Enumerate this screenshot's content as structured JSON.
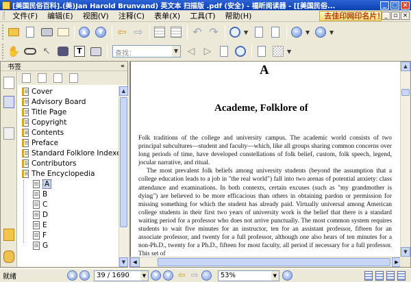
{
  "window": {
    "title": "[美国民俗百科].(美)Jan Harold Brunvand) 英文本 扫描版 .pdf (安全) - 福昕阅读器 - [[美国民俗..."
  },
  "menu": {
    "items": [
      "文件(F)",
      "编辑(E)",
      "视图(V)",
      "注释(C)",
      "表单(X)",
      "工具(T)",
      "帮助(H)"
    ],
    "banner": "去佳印网印名片！"
  },
  "toolbar": {
    "find_placeholder": "查找："
  },
  "bookmarks": {
    "header": "书签",
    "items": [
      {
        "label": "Cover",
        "level": 0
      },
      {
        "label": "Advisory Board",
        "level": 0
      },
      {
        "label": "Title Page",
        "level": 0
      },
      {
        "label": "Copyright",
        "level": 0
      },
      {
        "label": "Contents",
        "level": 0
      },
      {
        "label": "Preface",
        "level": 0
      },
      {
        "label": "Standard Folklore Indexes a",
        "level": 0
      },
      {
        "label": "Contributors",
        "level": 0
      },
      {
        "label": "The Encyclopedia",
        "level": 0
      },
      {
        "label": "A",
        "level": 1,
        "selected": true
      },
      {
        "label": "B",
        "level": 1
      },
      {
        "label": "C",
        "level": 1
      },
      {
        "label": "D",
        "level": 1
      },
      {
        "label": "E",
        "level": 1
      },
      {
        "label": "F",
        "level": 1
      },
      {
        "label": "G",
        "level": 1
      }
    ]
  },
  "document": {
    "letter": "A",
    "title": "Academe, Folklore of",
    "paragraphs": [
      "Folk traditions of the college and university campus. The academic world consists of two principal subcultures—student and faculty—which, like all groups sharing common concerns over long periods of time, have developed constellations of folk belief, custom, folk speech, legend, jocular narrative, and ritual.",
      "The most prevalent folk beliefs among university students (beyond the assumption that a college education leads to a job in \"the real world\") fall into two arenas of potential anxiety: class attendance and examinations. In both contexts, certain excuses (such as \"my grandmother is dying\") are believed to be more efficacious than others in obtaining pardon or permission for missing something for which the student has already paid. Virtually universal among American college students in their first two years of university work is the belief that there is a standard waiting period for a professor who does not arrive punctually. The most common system requires students to wait five minutes for an instructor, ten for an assistant professor, fifteen for an associate professor, and twenty for a full professor, although one also hears of ten minutes for a non-Ph.D., twenty for a Ph.D., fifteen for most faculty, all period if necessary for a full professor. This set of"
    ]
  },
  "status": {
    "text": "就绪",
    "page": "39 / 1690",
    "zoom": "53%"
  },
  "colors": {
    "titlebar": "#0a3fb0",
    "chrome": "#ece9d8",
    "accent": "#d79a18"
  }
}
